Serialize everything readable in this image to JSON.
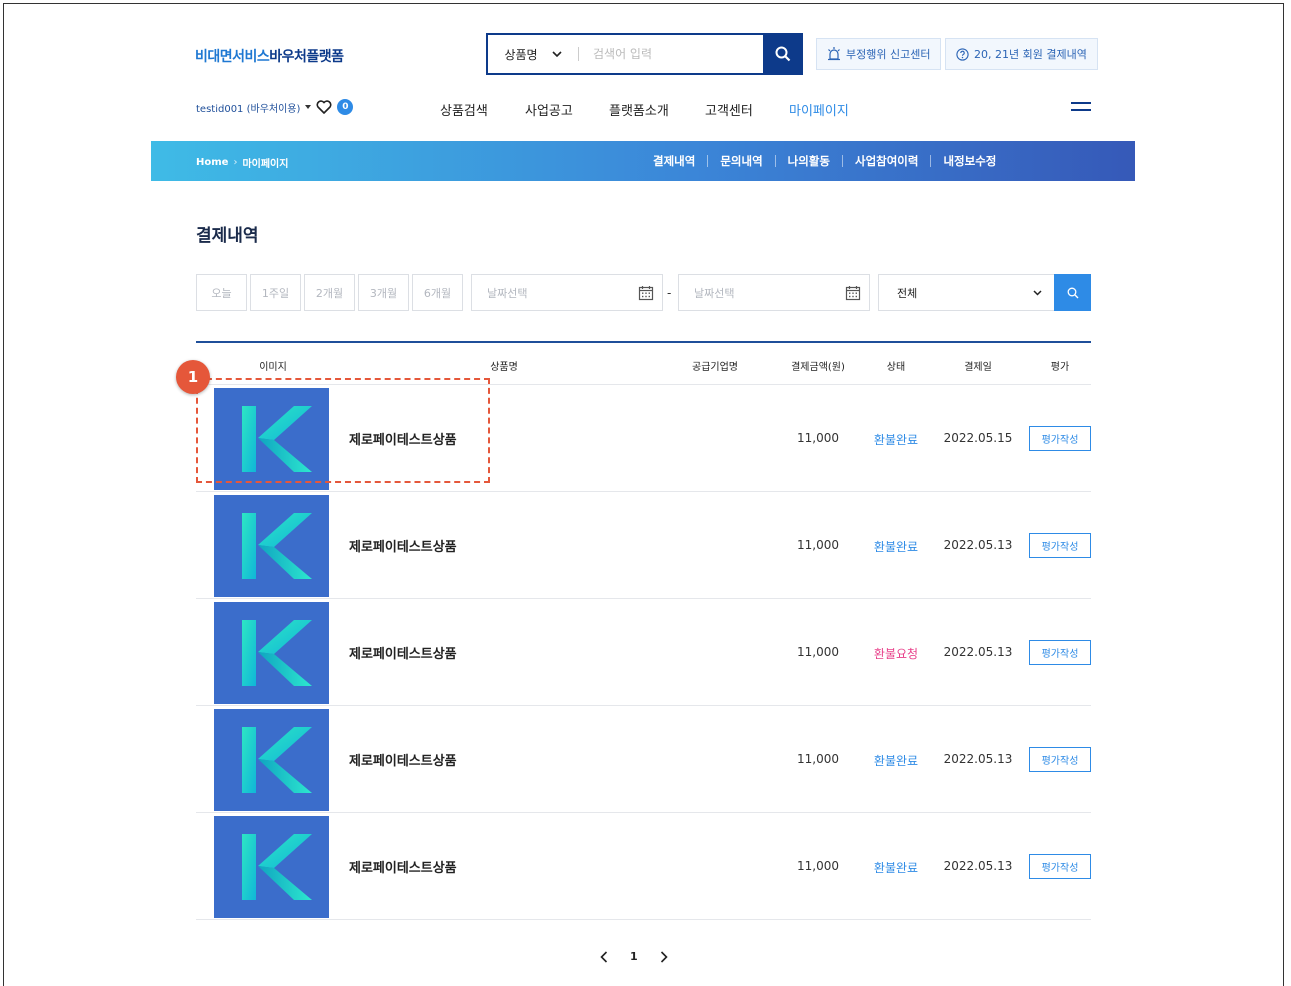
{
  "header": {
    "logo_part1": "비대면서비스",
    "logo_part2": "바우처플랫폼",
    "search": {
      "category": "상품명",
      "placeholder": "검색어 입력"
    },
    "report_button": "부정행위 신고센터",
    "history_button": "20, 21년 회원 결제내역",
    "user": {
      "id": "testid001 (바우처이용)",
      "wishlist_count": "0"
    },
    "nav": [
      "상품검색",
      "사업공고",
      "플랫폼소개",
      "고객센터",
      "마이페이지"
    ],
    "nav_active_color": "#2e8be6"
  },
  "band": {
    "breadcrumb": [
      "Home",
      "마이페이지"
    ],
    "subnav": [
      "결제내역",
      "문의내역",
      "나의활동",
      "사업참여이력",
      "내정보수정"
    ]
  },
  "page": {
    "title": "결제내역",
    "periods": [
      "오늘",
      "1주일",
      "2개월",
      "3개월",
      "6개월"
    ],
    "date_placeholder_from": "날짜선택",
    "date_placeholder_to": "날짜선택",
    "status_filter": "전체"
  },
  "table": {
    "columns": [
      "이미지",
      "상품명",
      "공급기업명",
      "결제금액(원)",
      "상태",
      "결제일",
      "평가"
    ],
    "rows": [
      {
        "name": "제로페이테스트상품",
        "supplier": "",
        "amount": "11,000",
        "status": "환불완료",
        "status_color": "#2e8be6",
        "date": "2022.05.15",
        "action": "평가작성"
      },
      {
        "name": "제로페이테스트상품",
        "supplier": "",
        "amount": "11,000",
        "status": "환불완료",
        "status_color": "#2e8be6",
        "date": "2022.05.13",
        "action": "평가작성"
      },
      {
        "name": "제로페이테스트상품",
        "supplier": "",
        "amount": "11,000",
        "status": "환불요청",
        "status_color": "#e8408a",
        "date": "2022.05.13",
        "action": "평가작성"
      },
      {
        "name": "제로페이테스트상품",
        "supplier": "",
        "amount": "11,000",
        "status": "환불완료",
        "status_color": "#2e8be6",
        "date": "2022.05.13",
        "action": "평가작성"
      },
      {
        "name": "제로페이테스트상품",
        "supplier": "",
        "amount": "11,000",
        "status": "환불완료",
        "status_color": "#2e8be6",
        "date": "2022.05.13",
        "action": "평가작성"
      }
    ]
  },
  "annotation": {
    "marker": "1",
    "color": "#e5573a"
  },
  "pagination": {
    "current": "1"
  }
}
